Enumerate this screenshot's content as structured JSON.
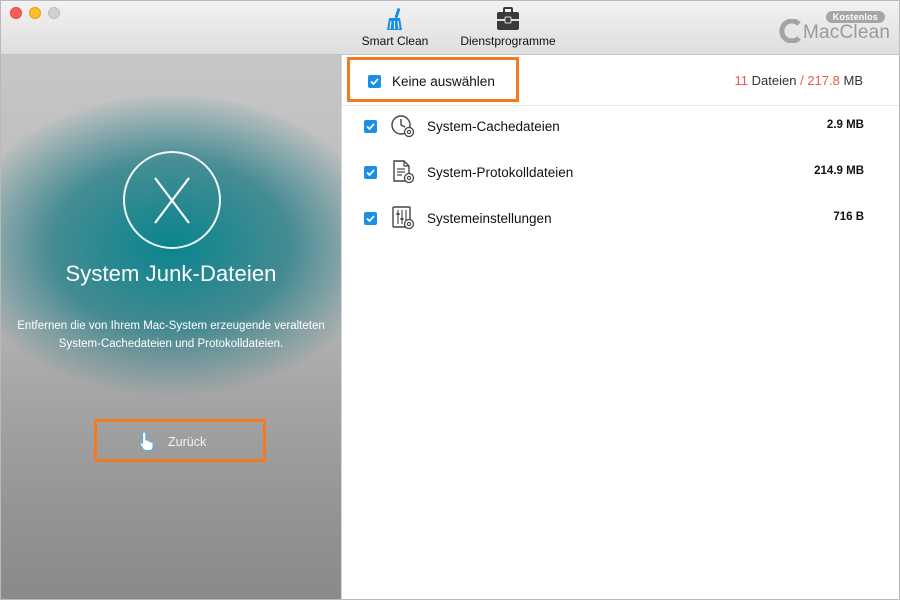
{
  "toolbar": {
    "smart_clean_label": "Smart Clean",
    "utilities_label": "Dienstprogramme",
    "badge": "Kostenlos",
    "brand": "MacClean",
    "accent_color": "#1a8fe6"
  },
  "left_panel": {
    "title": "System Junk-Dateien",
    "description": "Entfernen die von Ihrem Mac-System erzeugende veralteten System-Cachedateien und Protokolldateien.",
    "back_label": "Zurück"
  },
  "right_panel": {
    "select_all_label": "Keine auswählen",
    "summary": {
      "count": "11",
      "files_word": "Dateien",
      "separator": "/",
      "size": "217.8",
      "unit": "MB"
    },
    "items": [
      {
        "name": "System-Cachedateien",
        "size": "2.9 MB",
        "icon": "cache-clock-icon",
        "checked": true
      },
      {
        "name": "System-Protokolldateien",
        "size": "214.9 MB",
        "icon": "log-file-icon",
        "checked": true
      },
      {
        "name": "Systemeinstellungen",
        "size": "716 B",
        "icon": "settings-sliders-icon",
        "checked": true
      }
    ]
  },
  "highlight_color": "#f47a20"
}
